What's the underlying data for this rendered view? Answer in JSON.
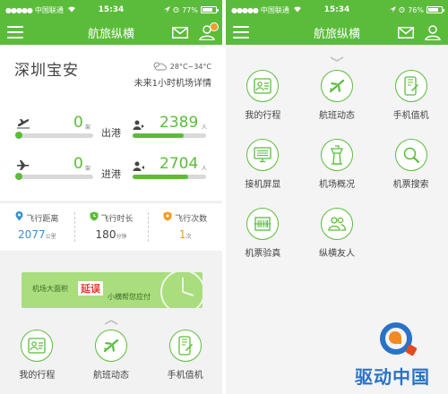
{
  "left": {
    "status": {
      "carrier": "中国联通",
      "time": "15:34",
      "battery": "77%",
      "battery_level": 0.77
    },
    "nav": {
      "title": "航旅纵横"
    },
    "weather": {
      "city": "深圳宝安",
      "temp": "28°C~34°C",
      "forecast_link": "未来1小时机场详情"
    },
    "departure": {
      "flights": "0",
      "flights_unit": "架",
      "label": "出港",
      "passengers": "2389",
      "passengers_unit": "人"
    },
    "arrival": {
      "flights": "0",
      "flights_unit": "架",
      "label": "进港",
      "passengers": "2704",
      "passengers_unit": "人"
    },
    "stats": [
      {
        "label": "飞行距离",
        "value": "2077",
        "unit": "公里"
      },
      {
        "label": "飞行时长",
        "value": "180",
        "unit": "分钟"
      },
      {
        "label": "飞行次数",
        "value": "1",
        "unit": "次"
      }
    ],
    "banner": {
      "text1": "机场大面积",
      "text2": "延误",
      "text3": "小横帮您应付"
    },
    "menu": [
      {
        "label": "我的行程",
        "icon": "itinerary-icon"
      },
      {
        "label": "航班动态",
        "icon": "plane-icon"
      },
      {
        "label": "手机值机",
        "icon": "phone-checkin-icon"
      }
    ]
  },
  "right": {
    "status": {
      "carrier": "中国联通",
      "time": "15:34",
      "battery": "76%",
      "battery_level": 0.76
    },
    "nav": {
      "title": "航旅纵横"
    },
    "menu": [
      {
        "label": "我的行程",
        "icon": "itinerary-icon"
      },
      {
        "label": "航班动态",
        "icon": "plane-icon"
      },
      {
        "label": "手机值机",
        "icon": "phone-checkin-icon"
      },
      {
        "label": "接机屏显",
        "icon": "screen-icon"
      },
      {
        "label": "机场概况",
        "icon": "tower-icon"
      },
      {
        "label": "机票搜索",
        "icon": "search-icon"
      },
      {
        "label": "机票验真",
        "icon": "ticket-verify-icon"
      },
      {
        "label": "纵横友人",
        "icon": "friends-icon"
      }
    ]
  },
  "watermark": {
    "text": "驱动中国"
  },
  "colors": {
    "brand": "#5bbc3b",
    "blue": "#3a8fd0",
    "orange": "#f39a1e"
  }
}
